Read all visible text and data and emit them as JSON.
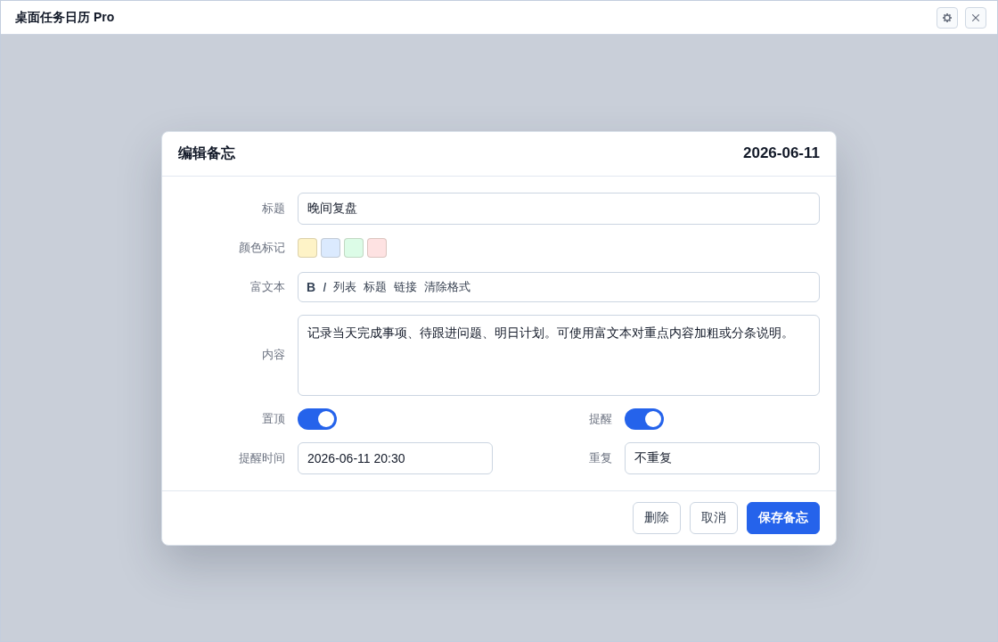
{
  "window": {
    "title": "桌面任务日历 Pro",
    "controls": [
      {
        "kind": "settings"
      },
      {
        "kind": "close"
      }
    ]
  },
  "dialog": {
    "title": "编辑备忘",
    "date": "2026-06-11",
    "rows": [
      {
        "fields": [
          {
            "kind": "text",
            "label": "标题",
            "value": "晚间复盘"
          }
        ]
      },
      {
        "fields": [
          {
            "kind": "swatches",
            "label": "颜色标记",
            "swatches": [
              {
                "color": "#fef3c7"
              },
              {
                "color": "#dbeafe"
              },
              {
                "color": "#dcfce7"
              },
              {
                "color": "#fee2e2"
              }
            ]
          }
        ]
      },
      {
        "fields": [
          {
            "kind": "toolbar",
            "label": "富文本",
            "tools": [
              {
                "label": "B",
                "kind": "bold"
              },
              {
                "label": "I",
                "kind": "italic"
              },
              {
                "label": "列表",
                "kind": "plain"
              },
              {
                "label": "标题",
                "kind": "plain"
              },
              {
                "label": "链接",
                "kind": "plain"
              },
              {
                "label": "清除格式",
                "kind": "plain"
              }
            ]
          }
        ]
      },
      {
        "fields": [
          {
            "kind": "textarea",
            "label": "内容",
            "value": "记录当天完成事项、待跟进问题、明日计划。可使用富文本对重点内容加粗或分条说明。"
          }
        ]
      },
      {
        "fields": [
          {
            "kind": "toggle",
            "label": "置顶",
            "on": true
          },
          {
            "kind": "toggle",
            "label": "提醒",
            "on": true
          }
        ]
      },
      {
        "fields": [
          {
            "kind": "text",
            "label": "提醒时间",
            "value": "2026-06-11 20:30"
          },
          {
            "kind": "text",
            "label": "重复",
            "value": "不重复"
          }
        ]
      }
    ],
    "buttons": [
      {
        "kind": "default",
        "label": "删除"
      },
      {
        "kind": "default",
        "label": "取消"
      },
      {
        "kind": "primary",
        "label": "保存备忘"
      }
    ]
  }
}
